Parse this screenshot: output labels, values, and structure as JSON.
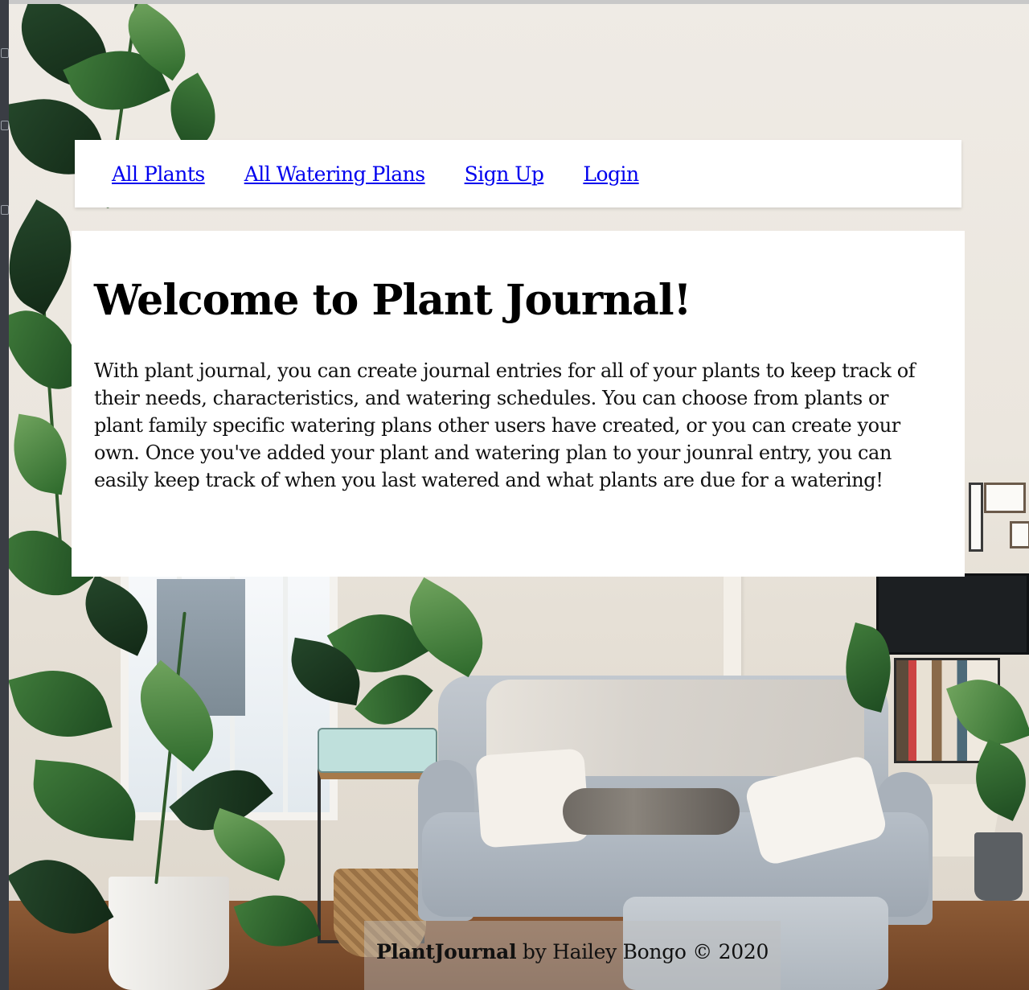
{
  "nav": {
    "links": [
      {
        "label": "All Plants"
      },
      {
        "label": "All Watering Plans"
      },
      {
        "label": "Sign Up"
      },
      {
        "label": "Login"
      }
    ]
  },
  "welcome": {
    "title": "Welcome to Plant Journal!",
    "body": "With plant journal, you can create journal entries for all of your plants to keep track of their needs, characteristics, and watering schedules. You can choose from plants or plant family specific watering plans other users have created, or you can create your own. Once you've added your plant and watering plan to your jounral entry, you can easily keep track of when you last watered and what plants are due for a watering!"
  },
  "footer": {
    "brand": "PlantJournal",
    "text": " by Hailey Bongo © 2020"
  },
  "colors": {
    "link": "#0000ee",
    "panel": "#ffffff"
  }
}
